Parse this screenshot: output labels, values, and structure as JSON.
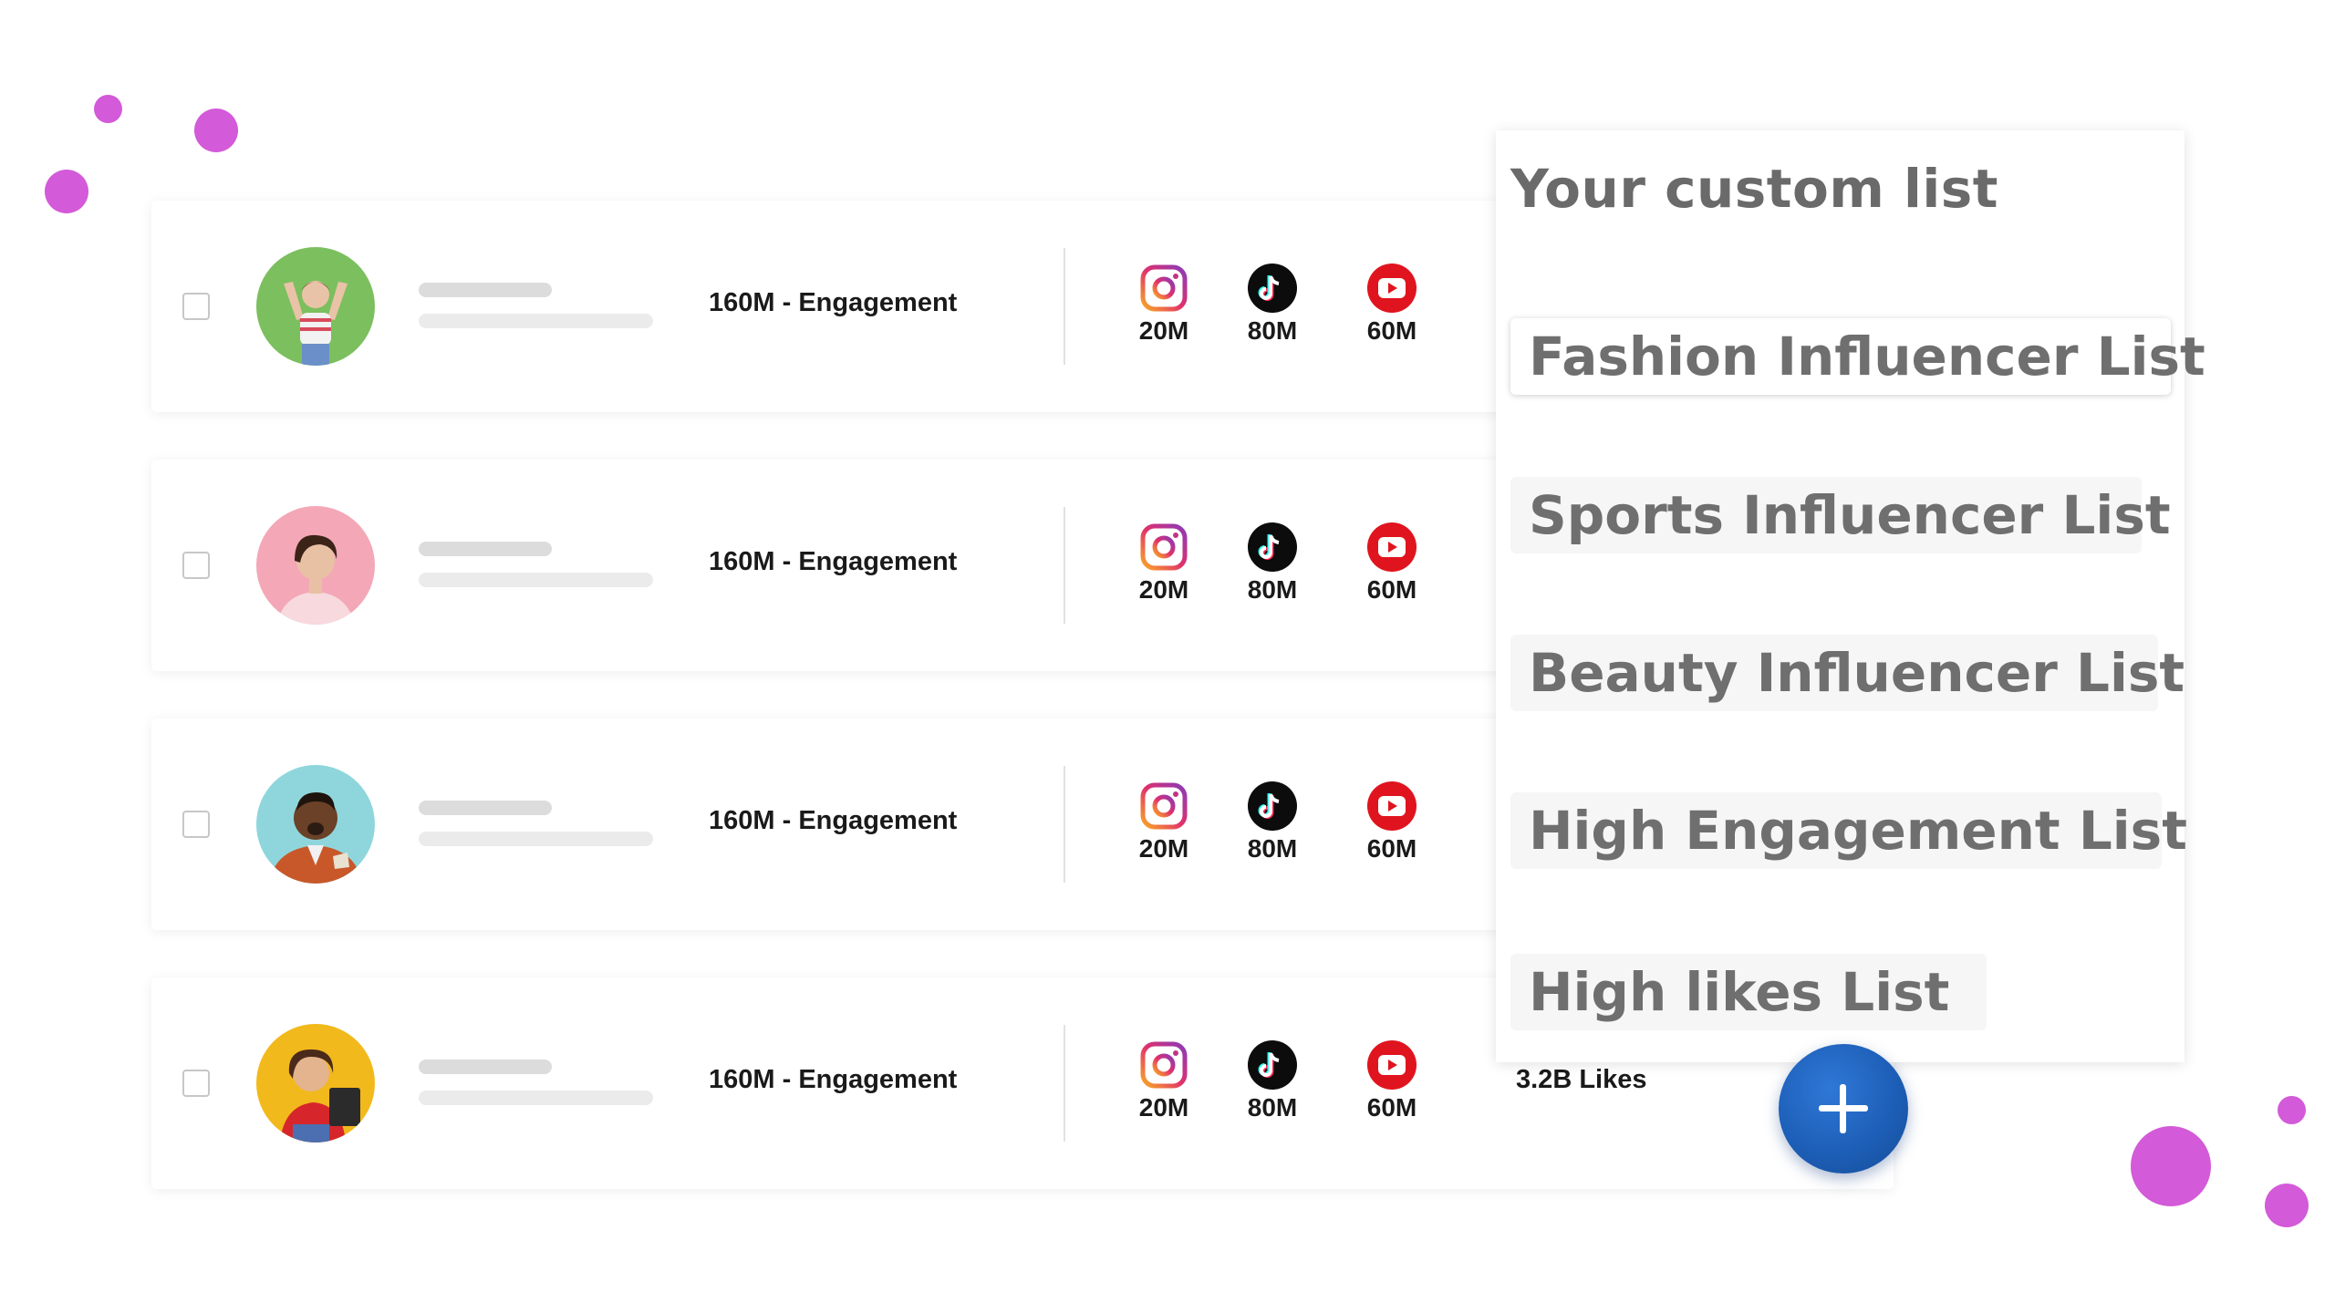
{
  "influencer_rows": [
    {
      "avatar_icon": "influencer-photo-green-bg",
      "engagement": "160M - Engagement",
      "stats": {
        "instagram": "20M",
        "tiktok": "80M",
        "youtube": "60M"
      }
    },
    {
      "avatar_icon": "influencer-photo-pink-bg",
      "engagement": "160M - Engagement",
      "stats": {
        "instagram": "20M",
        "tiktok": "80M",
        "youtube": "60M"
      }
    },
    {
      "avatar_icon": "influencer-photo-teal-bg",
      "engagement": "160M - Engagement",
      "stats": {
        "instagram": "20M",
        "tiktok": "80M",
        "youtube": "60M"
      }
    },
    {
      "avatar_icon": "influencer-photo-yellow-bg",
      "engagement": "160M - Engagement",
      "stats": {
        "instagram": "20M",
        "tiktok": "80M",
        "youtube": "60M"
      },
      "likes": "3.2B Likes"
    }
  ],
  "custom_list_panel": {
    "title": "Your custom list",
    "items": [
      {
        "label": "Fashion Influencer List"
      },
      {
        "label": "Sports Influencer List"
      },
      {
        "label": "Beauty Influencer List"
      },
      {
        "label": "High Engagement List"
      },
      {
        "label": "High likes List"
      }
    ]
  },
  "add_button": {
    "icon": "plus-icon"
  },
  "colors": {
    "accent_blue": "#1d5fb8",
    "decor_magenta": "#d35ad8",
    "youtube_red": "#e0141e"
  }
}
